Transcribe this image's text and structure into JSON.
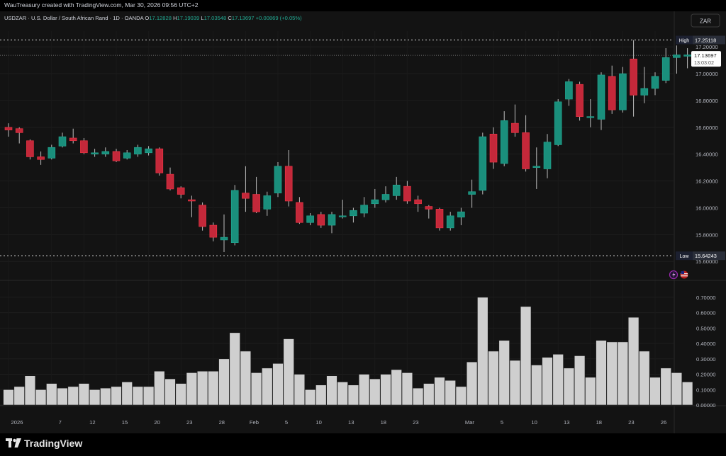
{
  "header": {
    "attribution": "WauTreasury created with TradingView.com, Mar 30, 2026 09:56 UTC+2"
  },
  "legend": {
    "symbol": "USDZAR · U.S. Dollar / South African Rand · 1D · OANDA",
    "o_label": "O",
    "o_value": "17.12828",
    "h_label": "H",
    "h_value": "17.19039",
    "l_label": "L",
    "l_value": "17.03548",
    "c_label": "C",
    "c_value": "17.13697",
    "change": "+0.00869 (+0.05%)"
  },
  "currency_button": "ZAR",
  "markers": {
    "high_label": "High",
    "high_value": "17.25118",
    "low_label": "Low",
    "low_value": "15.64243",
    "last_value": "17.13697",
    "countdown": "13:03:02"
  },
  "brand": {
    "name": "TradingView",
    "icon": "tradingview-logo-icon"
  },
  "colors": {
    "up": "#22ab94",
    "down": "#f23645",
    "up_fill": "#1a8f7c",
    "down_fill": "#c4283a",
    "volume": "#cfcfcf"
  },
  "chart_data": {
    "type": "candlestick",
    "price_ticks": [
      "17.20000",
      "17.00000",
      "16.80000",
      "16.60000",
      "16.40000",
      "16.20000",
      "16.00000",
      "15.80000",
      "15.60000"
    ],
    "volume_ticks": [
      "0.70000",
      "0.60000",
      "0.50000",
      "0.40000",
      "0.30000",
      "0.20000",
      "0.10000",
      "0.00000"
    ],
    "x_ticks": [
      {
        "label": "2026",
        "i": 0
      },
      {
        "label": "7",
        "i": 4
      },
      {
        "label": "12",
        "i": 7
      },
      {
        "label": "15",
        "i": 10
      },
      {
        "label": "20",
        "i": 13
      },
      {
        "label": "23",
        "i": 16
      },
      {
        "label": "28",
        "i": 19
      },
      {
        "label": "Feb",
        "i": 22
      },
      {
        "label": "5",
        "i": 25
      },
      {
        "label": "10",
        "i": 28
      },
      {
        "label": "13",
        "i": 31
      },
      {
        "label": "18",
        "i": 34
      },
      {
        "label": "23",
        "i": 37
      },
      {
        "label": "Mar",
        "i": 42
      },
      {
        "label": "5",
        "i": 45
      },
      {
        "label": "10",
        "i": 48
      },
      {
        "label": "13",
        "i": 51
      },
      {
        "label": "18",
        "i": 54
      },
      {
        "label": "23",
        "i": 57
      },
      {
        "label": "26",
        "i": 60
      }
    ],
    "price_range": [
      15.58,
      17.28
    ],
    "volume_range": [
      0,
      0.75
    ],
    "candles": [
      {
        "o": 16.6,
        "h": 16.63,
        "l": 16.53,
        "c": 16.58,
        "v": 0.1
      },
      {
        "o": 16.59,
        "h": 16.6,
        "l": 16.48,
        "c": 16.56,
        "v": 0.12
      },
      {
        "o": 16.5,
        "h": 16.51,
        "l": 16.36,
        "c": 16.38,
        "v": 0.19
      },
      {
        "o": 16.38,
        "h": 16.42,
        "l": 16.32,
        "c": 16.36,
        "v": 0.1
      },
      {
        "o": 16.37,
        "h": 16.47,
        "l": 16.36,
        "c": 16.45,
        "v": 0.14
      },
      {
        "o": 16.46,
        "h": 16.56,
        "l": 16.45,
        "c": 16.53,
        "v": 0.11
      },
      {
        "o": 16.52,
        "h": 16.59,
        "l": 16.48,
        "c": 16.5,
        "v": 0.12
      },
      {
        "o": 16.5,
        "h": 16.52,
        "l": 16.4,
        "c": 16.41,
        "v": 0.14
      },
      {
        "o": 16.4,
        "h": 16.44,
        "l": 16.38,
        "c": 16.41,
        "v": 0.1
      },
      {
        "o": 16.4,
        "h": 16.45,
        "l": 16.38,
        "c": 16.42,
        "v": 0.11
      },
      {
        "o": 16.42,
        "h": 16.44,
        "l": 16.34,
        "c": 16.35,
        "v": 0.12
      },
      {
        "o": 16.37,
        "h": 16.43,
        "l": 16.36,
        "c": 16.41,
        "v": 0.15
      },
      {
        "o": 16.4,
        "h": 16.47,
        "l": 16.38,
        "c": 16.45,
        "v": 0.12
      },
      {
        "o": 16.41,
        "h": 16.46,
        "l": 16.39,
        "c": 16.44,
        "v": 0.12
      },
      {
        "o": 16.44,
        "h": 16.45,
        "l": 16.24,
        "c": 16.26,
        "v": 0.22
      },
      {
        "o": 16.25,
        "h": 16.3,
        "l": 16.13,
        "c": 16.14,
        "v": 0.17
      },
      {
        "o": 16.15,
        "h": 16.16,
        "l": 16.07,
        "c": 16.1,
        "v": 0.14
      },
      {
        "o": 16.06,
        "h": 16.09,
        "l": 15.93,
        "c": 16.05,
        "v": 0.21
      },
      {
        "o": 16.02,
        "h": 16.04,
        "l": 15.83,
        "c": 15.86,
        "v": 0.22
      },
      {
        "o": 15.87,
        "h": 15.89,
        "l": 15.75,
        "c": 15.78,
        "v": 0.22
      },
      {
        "o": 15.76,
        "h": 15.95,
        "l": 15.67,
        "c": 15.78,
        "v": 0.3
      },
      {
        "o": 15.74,
        "h": 16.17,
        "l": 15.72,
        "c": 16.13,
        "v": 0.47
      },
      {
        "o": 16.11,
        "h": 16.31,
        "l": 15.97,
        "c": 16.07,
        "v": 0.35
      },
      {
        "o": 16.1,
        "h": 16.23,
        "l": 15.96,
        "c": 15.97,
        "v": 0.21
      },
      {
        "o": 15.99,
        "h": 16.12,
        "l": 15.94,
        "c": 16.09,
        "v": 0.24
      },
      {
        "o": 16.11,
        "h": 16.34,
        "l": 16.08,
        "c": 16.31,
        "v": 0.27
      },
      {
        "o": 16.31,
        "h": 16.43,
        "l": 16.01,
        "c": 16.05,
        "v": 0.43
      },
      {
        "o": 16.04,
        "h": 16.08,
        "l": 15.88,
        "c": 15.89,
        "v": 0.2
      },
      {
        "o": 15.89,
        "h": 15.96,
        "l": 15.87,
        "c": 15.94,
        "v": 0.1
      },
      {
        "o": 15.95,
        "h": 15.97,
        "l": 15.85,
        "c": 15.87,
        "v": 0.13
      },
      {
        "o": 15.87,
        "h": 15.97,
        "l": 15.81,
        "c": 15.95,
        "v": 0.19
      },
      {
        "o": 15.94,
        "h": 16.06,
        "l": 15.92,
        "c": 15.94,
        "v": 0.15
      },
      {
        "o": 15.94,
        "h": 16.0,
        "l": 15.89,
        "c": 15.98,
        "v": 0.13
      },
      {
        "o": 15.96,
        "h": 16.08,
        "l": 15.93,
        "c": 16.02,
        "v": 0.2
      },
      {
        "o": 16.03,
        "h": 16.14,
        "l": 16.0,
        "c": 16.06,
        "v": 0.17
      },
      {
        "o": 16.06,
        "h": 16.16,
        "l": 16.04,
        "c": 16.1,
        "v": 0.2
      },
      {
        "o": 16.09,
        "h": 16.23,
        "l": 16.06,
        "c": 16.17,
        "v": 0.23
      },
      {
        "o": 16.16,
        "h": 16.2,
        "l": 16.03,
        "c": 16.05,
        "v": 0.21
      },
      {
        "o": 16.06,
        "h": 16.09,
        "l": 15.97,
        "c": 16.03,
        "v": 0.11
      },
      {
        "o": 16.01,
        "h": 16.02,
        "l": 15.92,
        "c": 15.99,
        "v": 0.14
      },
      {
        "o": 15.99,
        "h": 16.0,
        "l": 15.83,
        "c": 15.85,
        "v": 0.18
      },
      {
        "o": 15.85,
        "h": 15.97,
        "l": 15.83,
        "c": 15.94,
        "v": 0.16
      },
      {
        "o": 15.93,
        "h": 16.0,
        "l": 15.87,
        "c": 15.97,
        "v": 0.12
      },
      {
        "o": 16.1,
        "h": 16.21,
        "l": 16.0,
        "c": 16.12,
        "v": 0.28
      },
      {
        "o": 16.13,
        "h": 16.56,
        "l": 16.1,
        "c": 16.53,
        "v": 0.7
      },
      {
        "o": 16.55,
        "h": 16.6,
        "l": 16.29,
        "c": 16.34,
        "v": 0.35
      },
      {
        "o": 16.33,
        "h": 16.72,
        "l": 16.31,
        "c": 16.65,
        "v": 0.42
      },
      {
        "o": 16.63,
        "h": 16.77,
        "l": 16.53,
        "c": 16.56,
        "v": 0.29
      },
      {
        "o": 16.56,
        "h": 16.69,
        "l": 16.27,
        "c": 16.29,
        "v": 0.64
      },
      {
        "o": 16.3,
        "h": 16.45,
        "l": 16.14,
        "c": 16.31,
        "v": 0.26
      },
      {
        "o": 16.29,
        "h": 16.55,
        "l": 16.22,
        "c": 16.49,
        "v": 0.31
      },
      {
        "o": 16.47,
        "h": 16.81,
        "l": 16.46,
        "c": 16.79,
        "v": 0.33
      },
      {
        "o": 16.81,
        "h": 16.96,
        "l": 16.76,
        "c": 16.94,
        "v": 0.24
      },
      {
        "o": 16.92,
        "h": 16.94,
        "l": 16.65,
        "c": 16.68,
        "v": 0.32
      },
      {
        "o": 16.68,
        "h": 16.81,
        "l": 16.6,
        "c": 16.68,
        "v": 0.18
      },
      {
        "o": 16.66,
        "h": 17.01,
        "l": 16.58,
        "c": 16.99,
        "v": 0.42
      },
      {
        "o": 16.98,
        "h": 17.06,
        "l": 16.7,
        "c": 16.73,
        "v": 0.41
      },
      {
        "o": 16.73,
        "h": 17.05,
        "l": 16.71,
        "c": 17.0,
        "v": 0.41
      },
      {
        "o": 17.11,
        "h": 17.25,
        "l": 16.68,
        "c": 16.84,
        "v": 0.57
      },
      {
        "o": 16.84,
        "h": 17.05,
        "l": 16.78,
        "c": 16.89,
        "v": 0.35
      },
      {
        "o": 16.89,
        "h": 17.01,
        "l": 16.84,
        "c": 16.98,
        "v": 0.18
      },
      {
        "o": 16.95,
        "h": 17.19,
        "l": 16.93,
        "c": 17.12,
        "v": 0.24
      },
      {
        "o": 17.12,
        "h": 17.21,
        "l": 17.0,
        "c": 17.14,
        "v": 0.21
      },
      {
        "o": 17.13,
        "h": 17.19,
        "l": 17.04,
        "c": 17.14,
        "v": 0.15
      }
    ]
  }
}
